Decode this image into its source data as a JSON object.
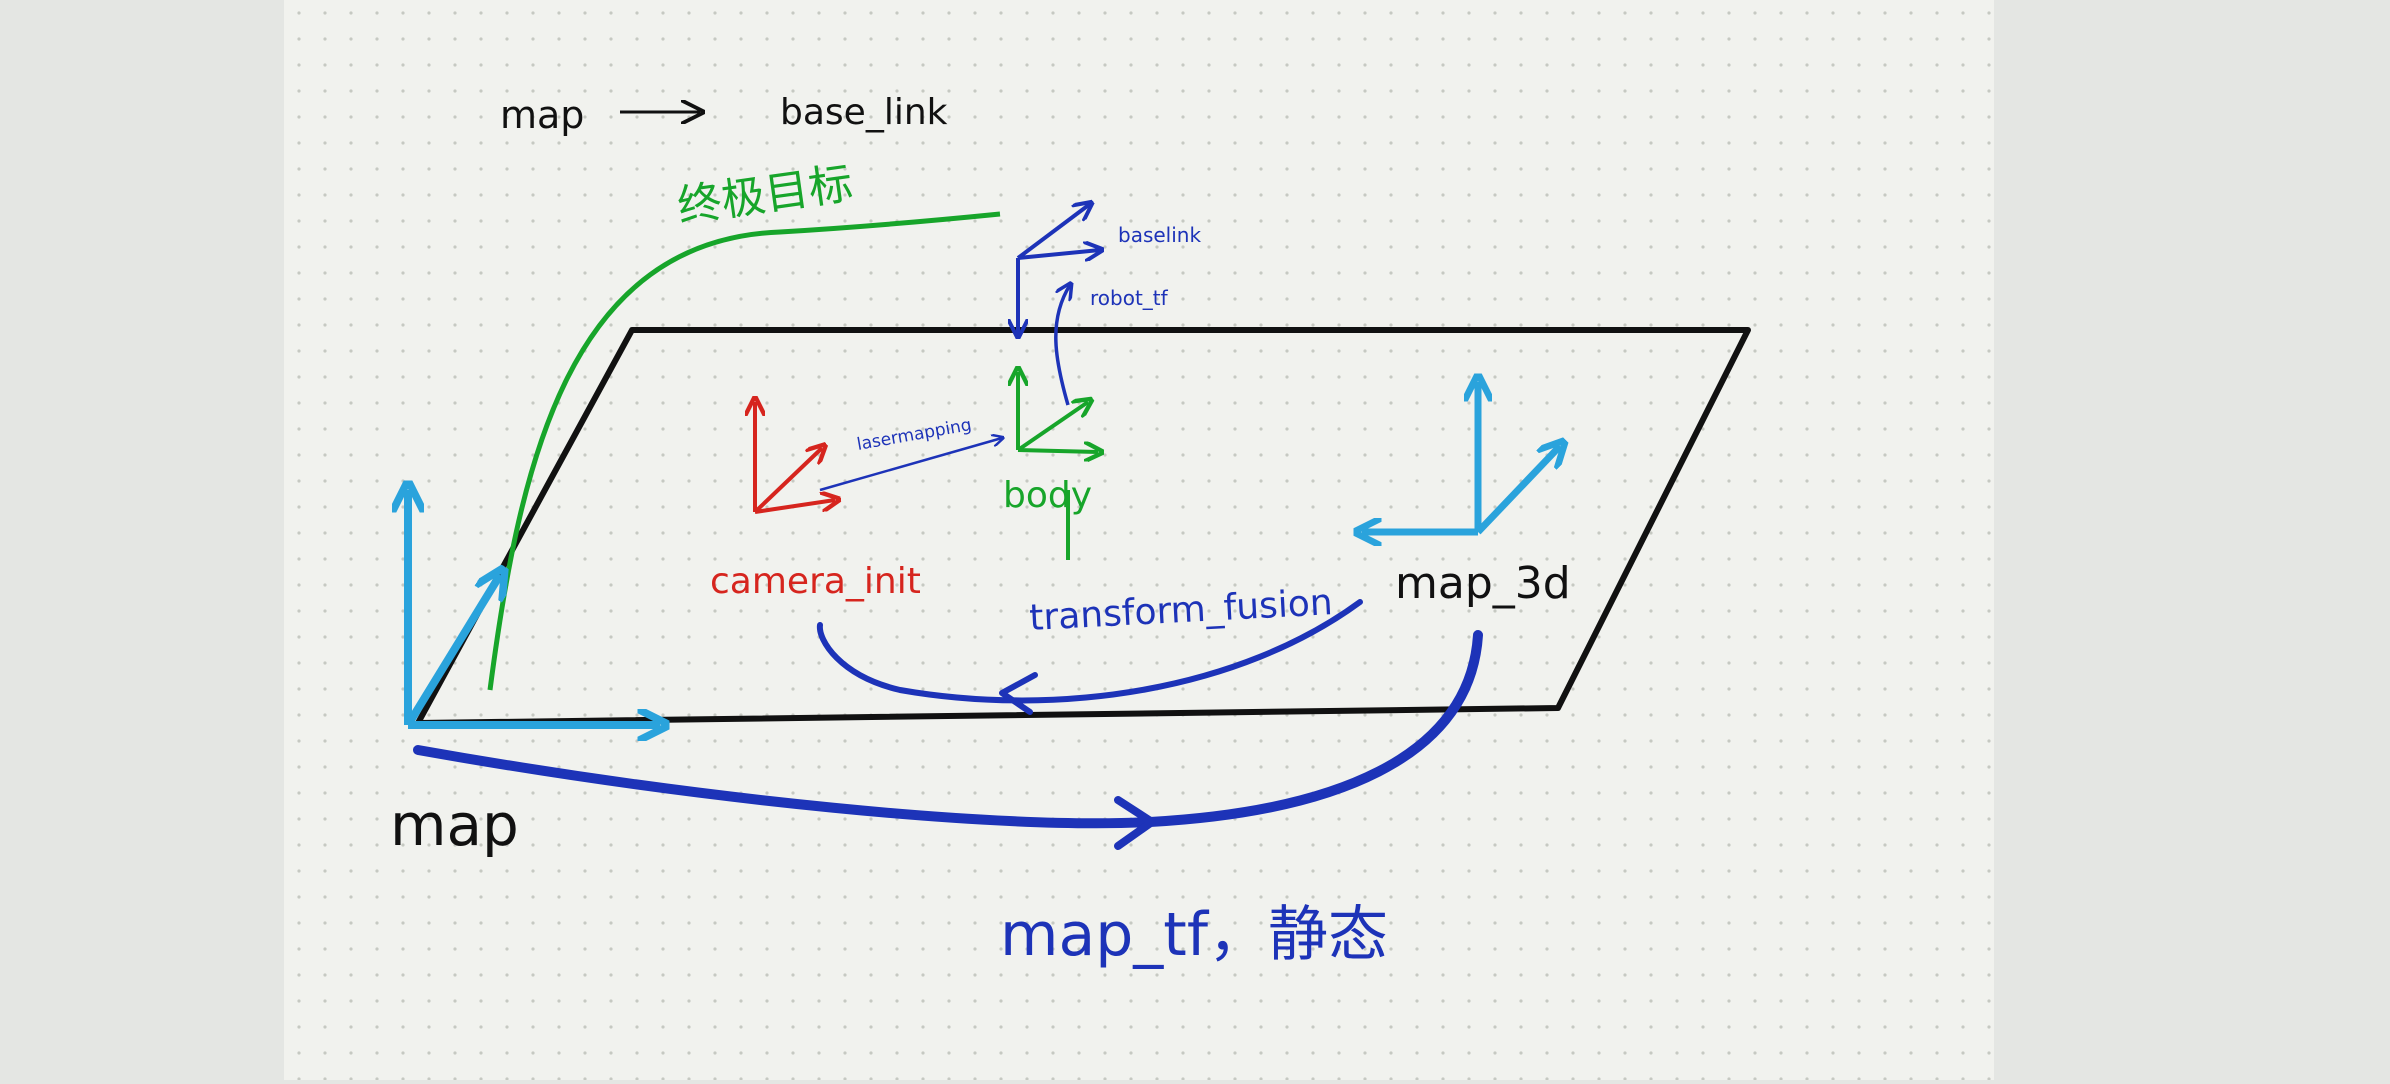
{
  "diagram": {
    "header": {
      "from": "map",
      "arrow": "⟶",
      "to": "base_link"
    },
    "frames": {
      "map": "map",
      "map_3d": "map_3d",
      "camera_init": "camera_init",
      "body": "body",
      "baselink": "baselink"
    },
    "edges": {
      "final_goal": "终极目标",
      "lasermapping": "lasermapping",
      "robot_tf": "robot_tf",
      "transform_fusion": "transform_fusion",
      "map_tf": "map_tf，静态"
    },
    "colors": {
      "paper": "#f1f2ee",
      "background": "#e4e6e3",
      "ink_black": "#111111",
      "ink_green": "#17a52a",
      "ink_blue": "#1d33b8",
      "ink_cyan": "#2aa3dc",
      "ink_red": "#d6251e"
    }
  }
}
